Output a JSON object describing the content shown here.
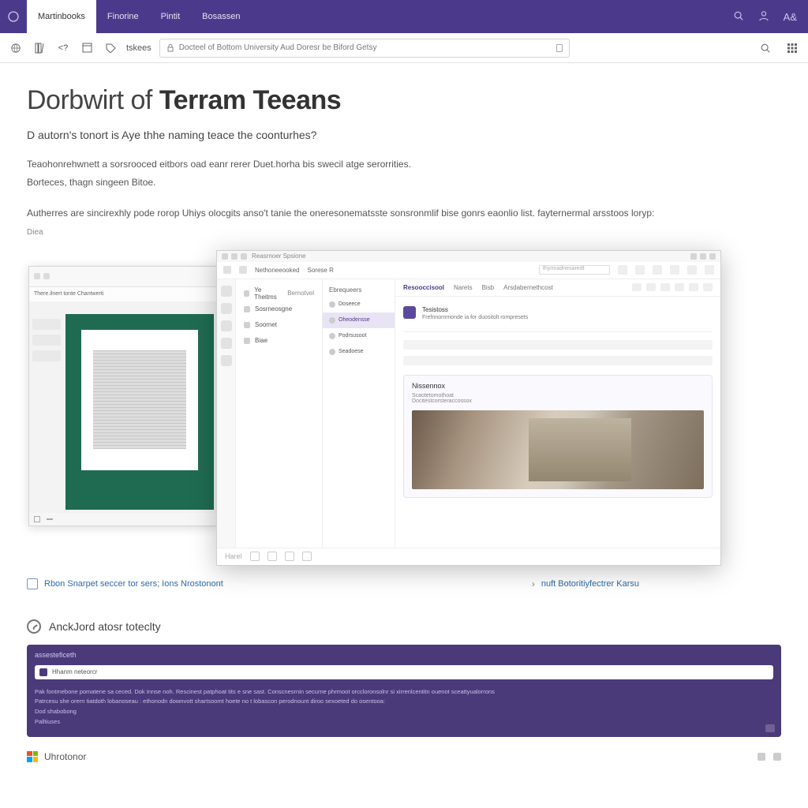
{
  "colors": {
    "accent": "#4b3a8c",
    "link": "#2f6aa8"
  },
  "topbar": {
    "tabs": [
      "Martinbooks",
      "Finorine",
      "Pintit",
      "Bosassen"
    ],
    "active_index": 0
  },
  "toolbar": {
    "label": "tskees",
    "url_text": "Docteel of Bottom University Aud Doresr be Biford Getsy"
  },
  "article": {
    "title_prefix": "Dorbwirt of ",
    "title_strong": "Terram Teeans",
    "lead": "D autorn's tonort is Aye thhe naming teace the coonturhes?",
    "body_line1": "Teaohonrehwnett a sorsrooced eitbors oad eanr rerer Duet.horha bis swecil atge serorrities.",
    "body_line2": "Borteces, thagn singeen Bitoe.",
    "body_line3": "Autherres are sincirexhly pode rorop Uhiys olocgits anso't tanie the oneresonematsste sonsronmlif bise gonrs eaonlio list.   fayternermal arsstoos loryp:",
    "caption": "Diea"
  },
  "back_panel": {
    "title": "There.ilnert tonte Chantwerti"
  },
  "front_panel": {
    "title": "Reasrnoer Spsione",
    "left_label": "Nethoneeooked",
    "right_label": "Sorese R",
    "search_placeholder": "thyrmadnesaredt",
    "nav": [
      "Ye Theitms",
      "Bernotvel",
      "Sosrneosgne",
      "Soornet",
      "Biae"
    ],
    "channels_header": "Ebrequeers",
    "channels": [
      "Doseece",
      "Oheodensse",
      "Podrsusoot",
      "Seadoese"
    ],
    "active_channel_index": 1,
    "main_tabs": [
      "Resooccisool",
      "Narets",
      "Bisb",
      "Arsdabernethcost"
    ],
    "post": {
      "name": "Tesistoss",
      "msg": "Frefnnornmonde ia for duositolt rompresets"
    },
    "card": {
      "title": "Nissennox",
      "line1": "Scaotetomothoat",
      "line2": "Docitestcorsteraccossox"
    },
    "compose_placeholder": "Harel"
  },
  "under_links": {
    "left": "Rbon Snarpet seccer tor sers; Ions Nrostonont",
    "right": "nuft Botoritiyfectrer Karsu"
  },
  "section2_title": "AnckJord atosr toteclty",
  "dark_panel": {
    "head": "assesteficeth",
    "bar_text": "Hhanm neteorcr",
    "lines": [
      "Pak fontmebone pomatene sa ceced. Dok Innse noh. Rescinest patphoat tits e sne sast. Conscnesrnin securne phrmoot orccloronsolnr si xirrenlcentitn ouenot sceattyualorrons",
      "Patrcesu she orern tiatdoth lobanoseau : ethonodn downvott shartsoomt hoete no t lobascon perodnount diroo sexoeted do osentooa:",
      "Dod shabobong",
      "Palltiuses"
    ]
  },
  "brand": "Uhrotonor"
}
